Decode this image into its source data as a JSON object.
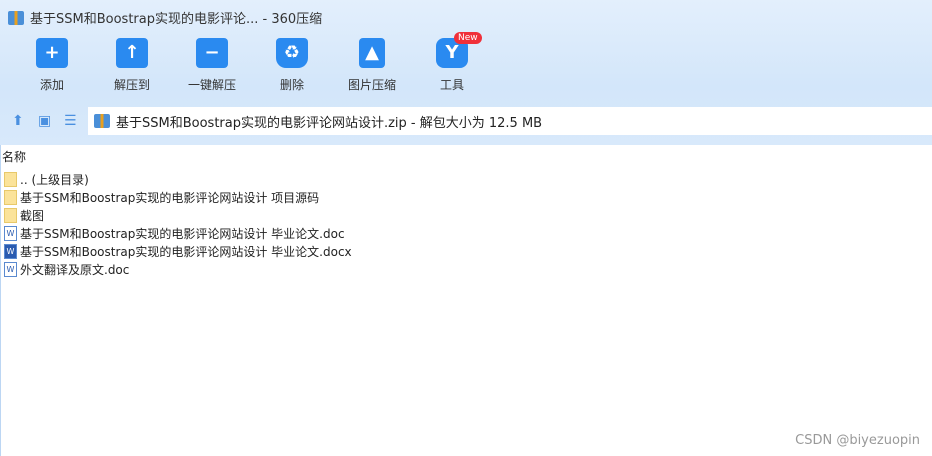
{
  "window": {
    "title": "基于SSM和Boostrap实现的电影评论... - 360压缩"
  },
  "toolbar": [
    {
      "label": "添加",
      "icon": "+"
    },
    {
      "label": "解压到",
      "icon": "↑"
    },
    {
      "label": "一键解压",
      "icon": "−"
    },
    {
      "label": "删除",
      "icon": "♻"
    },
    {
      "label": "图片压缩",
      "icon": "▲"
    },
    {
      "label": "工具",
      "icon": "Y"
    }
  ],
  "badge": "New",
  "address": "基于SSM和Boostrap实现的电影评论网站设计.zip - 解包大小为 12.5 MB",
  "column": "名称",
  "files": [
    {
      "name": ".. (上级目录)",
      "type": "folder"
    },
    {
      "name": "基于SSM和Boostrap实现的电影评论网站设计 项目源码",
      "type": "folder"
    },
    {
      "name": "截图",
      "type": "folder"
    },
    {
      "name": "基于SSM和Boostrap实现的电影评论网站设计 毕业论文.doc",
      "type": "doc"
    },
    {
      "name": "基于SSM和Boostrap实现的电影评论网站设计 毕业论文.docx",
      "type": "docx"
    },
    {
      "name": "外文翻译及原文.doc",
      "type": "doc"
    }
  ],
  "watermark": "CSDN @biyezuopin"
}
